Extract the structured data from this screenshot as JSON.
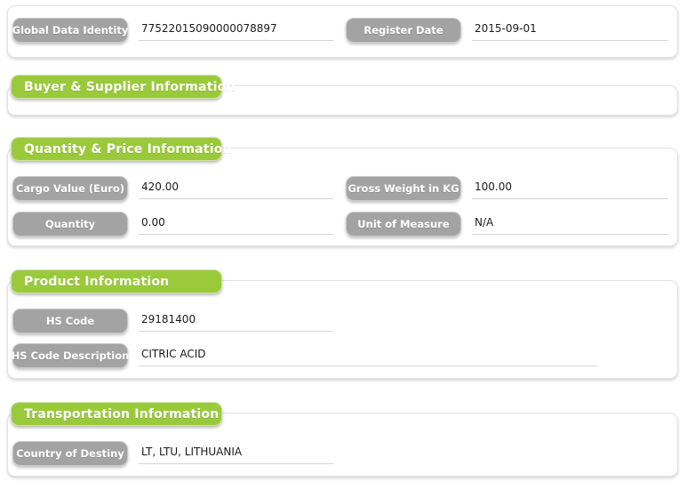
{
  "theme": {
    "accent_green": "#9aca3c",
    "label_gray": "#a3a3a3",
    "panel_border": "#e2e2e2",
    "underline": "#d6d6d6",
    "value_text": "#1a1a1a",
    "page_background": "#ffffff"
  },
  "panels": [
    {
      "id": "header-panel",
      "title": null,
      "fields": [
        {
          "label": "Global Data Identity",
          "value": "77522015090000078897"
        },
        {
          "label": "Register Date",
          "value": "2015-09-01"
        }
      ]
    },
    {
      "id": "buyer-supplier-panel",
      "title": "Buyer & Supplier Information",
      "fields": []
    },
    {
      "id": "quantity-price-panel",
      "title": "Quantity & Price Information",
      "fields": [
        {
          "label": "Cargo Value (Euro)",
          "value": "420.00"
        },
        {
          "label": "Gross Weight in KG",
          "value": "100.00"
        },
        {
          "label": "Quantity",
          "value": "0.00"
        },
        {
          "label": "Unit of Measure",
          "value": "N/A"
        }
      ]
    },
    {
      "id": "product-information-panel",
      "title": "Product Information",
      "fields": [
        {
          "label": "HS Code",
          "value": "29181400"
        },
        {
          "label": "HS Code Description",
          "value": "CITRIC ACID"
        }
      ]
    },
    {
      "id": "transportation-information-panel",
      "title": "Transportation Information",
      "fields": [
        {
          "label": "Country of Destiny",
          "value": "LT, LTU, LITHUANIA"
        }
      ]
    }
  ]
}
